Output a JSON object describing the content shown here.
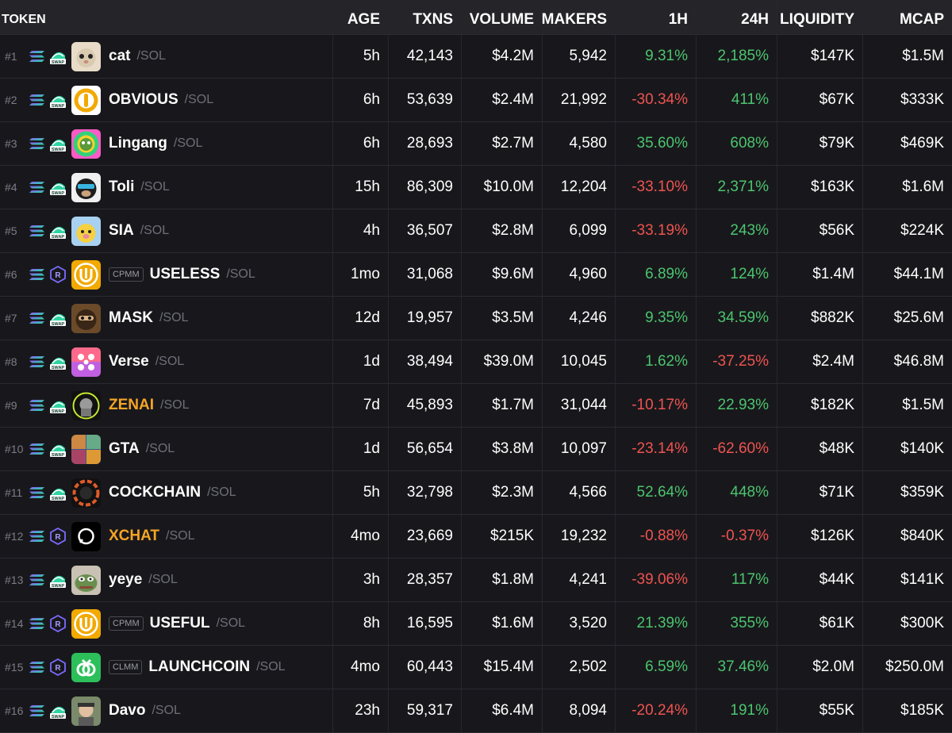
{
  "headers": {
    "token": "TOKEN",
    "age": "AGE",
    "txns": "TXNS",
    "volume": "VOLUME",
    "makers": "MAKERS",
    "h1": "1H",
    "h24": "24H",
    "liquidity": "LIQUIDITY",
    "mcap": "MCAP"
  },
  "colors": {
    "positive": "#4cc46e",
    "negative": "#ef5350",
    "highlight": "#f5a524"
  },
  "rows": [
    {
      "rank": "#1",
      "dex": "swap",
      "badge": "",
      "symbol": "cat",
      "quote": "/SOL",
      "age": "5h",
      "txns": "42,143",
      "volume": "$4.2M",
      "makers": "5,942",
      "h1": "9.31%",
      "h24": "2,185%",
      "liquidity": "$147K",
      "mcap": "$1.5M",
      "h1_sign": "pos",
      "h24_sign": "pos",
      "highlight": false,
      "avatar": "cat-avatar"
    },
    {
      "rank": "#2",
      "dex": "swap",
      "badge": "",
      "symbol": "OBVIOUS",
      "quote": "/SOL",
      "age": "6h",
      "txns": "53,639",
      "volume": "$2.4M",
      "makers": "21,992",
      "h1": "-30.34%",
      "h24": "411%",
      "liquidity": "$67K",
      "mcap": "$333K",
      "h1_sign": "neg",
      "h24_sign": "pos",
      "highlight": false,
      "avatar": "coin-avatar"
    },
    {
      "rank": "#3",
      "dex": "swap",
      "badge": "",
      "symbol": "Lingang",
      "quote": "/SOL",
      "age": "6h",
      "txns": "28,693",
      "volume": "$2.7M",
      "makers": "4,580",
      "h1": "35.60%",
      "h24": "608%",
      "liquidity": "$79K",
      "mcap": "$469K",
      "h1_sign": "pos",
      "h24_sign": "pos",
      "highlight": false,
      "avatar": "frog-avatar"
    },
    {
      "rank": "#4",
      "dex": "swap",
      "badge": "",
      "symbol": "Toli",
      "quote": "/SOL",
      "age": "15h",
      "txns": "86,309",
      "volume": "$10.0M",
      "makers": "12,204",
      "h1": "-33.10%",
      "h24": "2,371%",
      "liquidity": "$163K",
      "mcap": "$1.6M",
      "h1_sign": "neg",
      "h24_sign": "pos",
      "highlight": false,
      "avatar": "monkey-avatar"
    },
    {
      "rank": "#5",
      "dex": "swap",
      "badge": "",
      "symbol": "SIA",
      "quote": "/SOL",
      "age": "4h",
      "txns": "36,507",
      "volume": "$2.8M",
      "makers": "6,099",
      "h1": "-33.19%",
      "h24": "243%",
      "liquidity": "$56K",
      "mcap": "$224K",
      "h1_sign": "neg",
      "h24_sign": "pos",
      "highlight": false,
      "avatar": "dog-avatar"
    },
    {
      "rank": "#6",
      "dex": "raydium",
      "badge": "CPMM",
      "symbol": "USELESS",
      "quote": "/SOL",
      "age": "1mo",
      "txns": "31,068",
      "volume": "$9.6M",
      "makers": "4,960",
      "h1": "6.89%",
      "h24": "124%",
      "liquidity": "$1.4M",
      "mcap": "$44.1M",
      "h1_sign": "pos",
      "h24_sign": "pos",
      "highlight": false,
      "avatar": "useless-avatar"
    },
    {
      "rank": "#7",
      "dex": "swap",
      "badge": "",
      "symbol": "MASK",
      "quote": "/SOL",
      "age": "12d",
      "txns": "19,957",
      "volume": "$3.5M",
      "makers": "4,246",
      "h1": "9.35%",
      "h24": "34.59%",
      "liquidity": "$882K",
      "mcap": "$25.6M",
      "h1_sign": "pos",
      "h24_sign": "pos",
      "highlight": false,
      "avatar": "mask-avatar"
    },
    {
      "rank": "#8",
      "dex": "swap",
      "badge": "",
      "symbol": "Verse",
      "quote": "/SOL",
      "age": "1d",
      "txns": "38,494",
      "volume": "$39.0M",
      "makers": "10,045",
      "h1": "1.62%",
      "h24": "-37.25%",
      "liquidity": "$2.4M",
      "mcap": "$46.8M",
      "h1_sign": "pos",
      "h24_sign": "neg",
      "highlight": false,
      "avatar": "verse-avatar"
    },
    {
      "rank": "#9",
      "dex": "swap",
      "badge": "",
      "symbol": "ZENAI",
      "quote": "/SOL",
      "age": "7d",
      "txns": "45,893",
      "volume": "$1.7M",
      "makers": "31,044",
      "h1": "-10.17%",
      "h24": "22.93%",
      "liquidity": "$182K",
      "mcap": "$1.5M",
      "h1_sign": "neg",
      "h24_sign": "pos",
      "highlight": true,
      "avatar": "zenai-avatar"
    },
    {
      "rank": "#10",
      "dex": "swap",
      "badge": "",
      "symbol": "GTA",
      "quote": "/SOL",
      "age": "1d",
      "txns": "56,654",
      "volume": "$3.8M",
      "makers": "10,097",
      "h1": "-23.14%",
      "h24": "-62.60%",
      "liquidity": "$48K",
      "mcap": "$140K",
      "h1_sign": "neg",
      "h24_sign": "neg",
      "highlight": false,
      "avatar": "gta-avatar"
    },
    {
      "rank": "#11",
      "dex": "swap",
      "badge": "",
      "symbol": "COCKCHAIN",
      "quote": "/SOL",
      "age": "5h",
      "txns": "32,798",
      "volume": "$2.3M",
      "makers": "4,566",
      "h1": "52.64%",
      "h24": "448%",
      "liquidity": "$71K",
      "mcap": "$359K",
      "h1_sign": "pos",
      "h24_sign": "pos",
      "highlight": false,
      "avatar": "cockchain-avatar"
    },
    {
      "rank": "#12",
      "dex": "raydium",
      "badge": "",
      "symbol": "XCHAT",
      "quote": "/SOL",
      "age": "4mo",
      "txns": "23,669",
      "volume": "$215K",
      "makers": "19,232",
      "h1": "-0.88%",
      "h24": "-0.37%",
      "liquidity": "$126K",
      "mcap": "$840K",
      "h1_sign": "neg",
      "h24_sign": "neg",
      "highlight": true,
      "avatar": "xchat-avatar"
    },
    {
      "rank": "#13",
      "dex": "swap",
      "badge": "",
      "symbol": "yeye",
      "quote": "/SOL",
      "age": "3h",
      "txns": "28,357",
      "volume": "$1.8M",
      "makers": "4,241",
      "h1": "-39.06%",
      "h24": "117%",
      "liquidity": "$44K",
      "mcap": "$141K",
      "h1_sign": "neg",
      "h24_sign": "pos",
      "highlight": false,
      "avatar": "pepe-avatar"
    },
    {
      "rank": "#14",
      "dex": "raydium",
      "badge": "CPMM",
      "symbol": "USEFUL",
      "quote": "/SOL",
      "age": "8h",
      "txns": "16,595",
      "volume": "$1.6M",
      "makers": "3,520",
      "h1": "21.39%",
      "h24": "355%",
      "liquidity": "$61K",
      "mcap": "$300K",
      "h1_sign": "pos",
      "h24_sign": "pos",
      "highlight": false,
      "avatar": "useful-avatar"
    },
    {
      "rank": "#15",
      "dex": "raydium",
      "badge": "CLMM",
      "symbol": "LAUNCHCOIN",
      "quote": "/SOL",
      "age": "4mo",
      "txns": "60,443",
      "volume": "$15.4M",
      "makers": "2,502",
      "h1": "6.59%",
      "h24": "37.46%",
      "liquidity": "$2.0M",
      "mcap": "$250.0M",
      "h1_sign": "pos",
      "h24_sign": "pos",
      "highlight": false,
      "avatar": "launchcoin-avatar"
    },
    {
      "rank": "#16",
      "dex": "swap",
      "badge": "",
      "symbol": "Davo",
      "quote": "/SOL",
      "age": "23h",
      "txns": "59,317",
      "volume": "$6.4M",
      "makers": "8,094",
      "h1": "-20.24%",
      "h24": "191%",
      "liquidity": "$55K",
      "mcap": "$185K",
      "h1_sign": "neg",
      "h24_sign": "pos",
      "highlight": false,
      "avatar": "davo-avatar"
    }
  ]
}
